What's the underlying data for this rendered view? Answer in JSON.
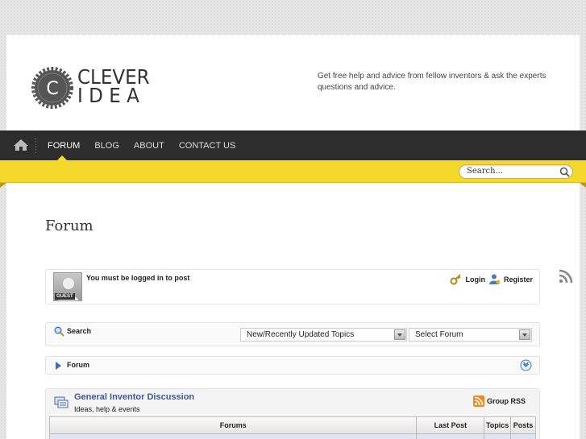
{
  "brand": {
    "line1": "CLEVER",
    "line2": "IDEA",
    "badge_letter": "C"
  },
  "tagline": "Get free help and advice from fellow inventors & ask the experts questions and advice.",
  "nav": {
    "items": [
      "FORUM",
      "BLOG",
      "ABOUT",
      "CONTACT US"
    ],
    "active": "FORUM"
  },
  "search": {
    "value": "Search..."
  },
  "page_title": "Forum",
  "login_panel": {
    "message": "You must be logged in to post",
    "avatar_tag": "GUEST",
    "login_label": "Login",
    "register_label": "Register"
  },
  "search_panel": {
    "label": "Search",
    "type_select": "New/Recently Updated Topics",
    "forum_select": "Select Forum"
  },
  "breadcrumb": {
    "label": "Forum"
  },
  "category": {
    "title": "General Inventor Discussion",
    "description": "Ideas, help & events",
    "rss_label": "Group RSS",
    "columns": [
      "Forums",
      "Last Post",
      "Topics",
      "Posts"
    ]
  },
  "colors": {
    "nav_bg": "#2d2d2d",
    "accent_yellow": "#f4d82a",
    "link_blue": "#3b5b9a"
  },
  "icons": [
    "home-icon",
    "rss-icon",
    "search-icon",
    "key-icon",
    "user-icon",
    "magnifier-icon",
    "collapse-icon",
    "forum-list-icon"
  ]
}
